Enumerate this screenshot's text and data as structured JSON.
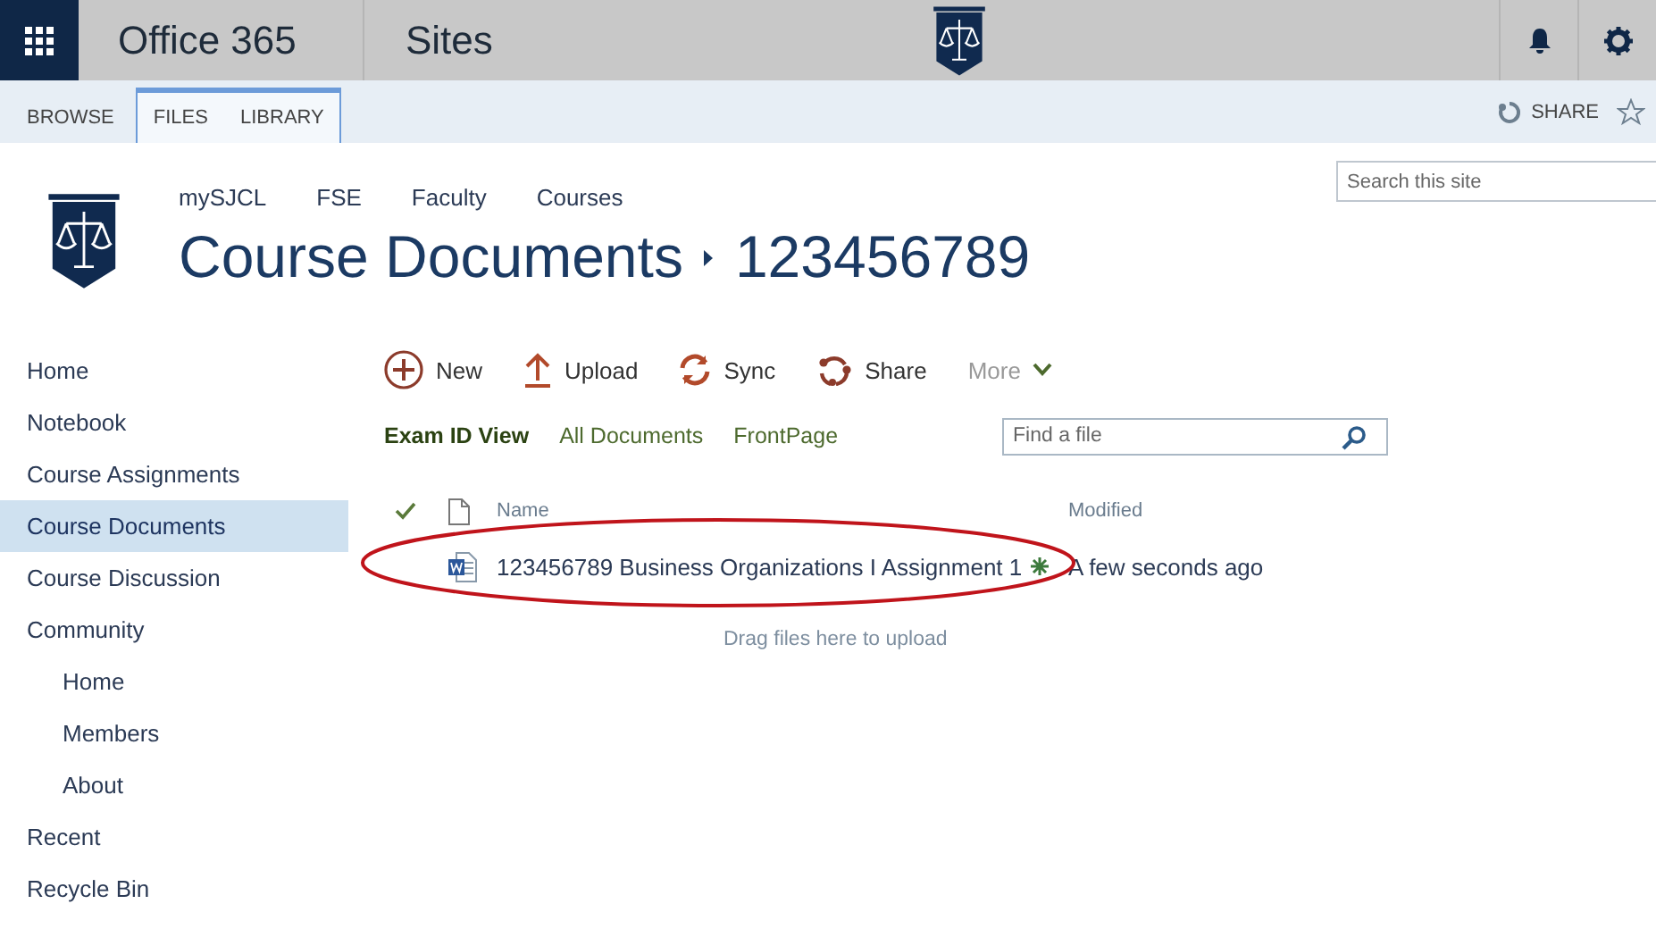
{
  "suite_bar": {
    "brand": "Office 365",
    "app": "Sites"
  },
  "ribbon": {
    "tabs": [
      {
        "label": "BROWSE",
        "contextual": false
      },
      {
        "label": "FILES",
        "contextual": true
      },
      {
        "label": "LIBRARY",
        "contextual": true
      }
    ],
    "share": "SHARE"
  },
  "header": {
    "top_links": [
      "mySJCL",
      "FSE",
      "Faculty",
      "Courses"
    ],
    "title": "Course Documents",
    "subtitle": "123456789",
    "search": {
      "placeholder": "Search this site"
    }
  },
  "sidebar": {
    "items": [
      {
        "label": "Home",
        "selected": false
      },
      {
        "label": "Notebook",
        "selected": false
      },
      {
        "label": "Course Assignments",
        "selected": false
      },
      {
        "label": "Course Documents",
        "selected": true
      },
      {
        "label": "Course Discussion",
        "selected": false
      },
      {
        "label": "Community",
        "selected": false,
        "children": [
          {
            "label": "Home",
            "selected": false
          },
          {
            "label": "Members",
            "selected": false
          },
          {
            "label": "About",
            "selected": false
          }
        ]
      },
      {
        "label": "Recent",
        "selected": false
      },
      {
        "label": "Recycle Bin",
        "selected": false
      }
    ]
  },
  "commands": [
    {
      "kind": "new",
      "label": "New",
      "disabled": false
    },
    {
      "kind": "upload",
      "label": "Upload",
      "disabled": false
    },
    {
      "kind": "sync",
      "label": "Sync",
      "disabled": false
    },
    {
      "kind": "share",
      "label": "Share",
      "disabled": false
    },
    {
      "kind": "more",
      "label": "More",
      "disabled": true
    }
  ],
  "views": [
    {
      "label": "Exam ID View",
      "selected": true
    },
    {
      "label": "All Documents",
      "selected": false
    },
    {
      "label": "FrontPage",
      "selected": false
    }
  ],
  "find": {
    "placeholder": "Find a file"
  },
  "table": {
    "columns": [
      "Name",
      "Modified"
    ],
    "rows": [
      {
        "name": "123456789 Business Organizations I Assignment 1",
        "new": true,
        "modified": "A few seconds ago"
      }
    ]
  },
  "drop_hint": "Drag files here to upload"
}
